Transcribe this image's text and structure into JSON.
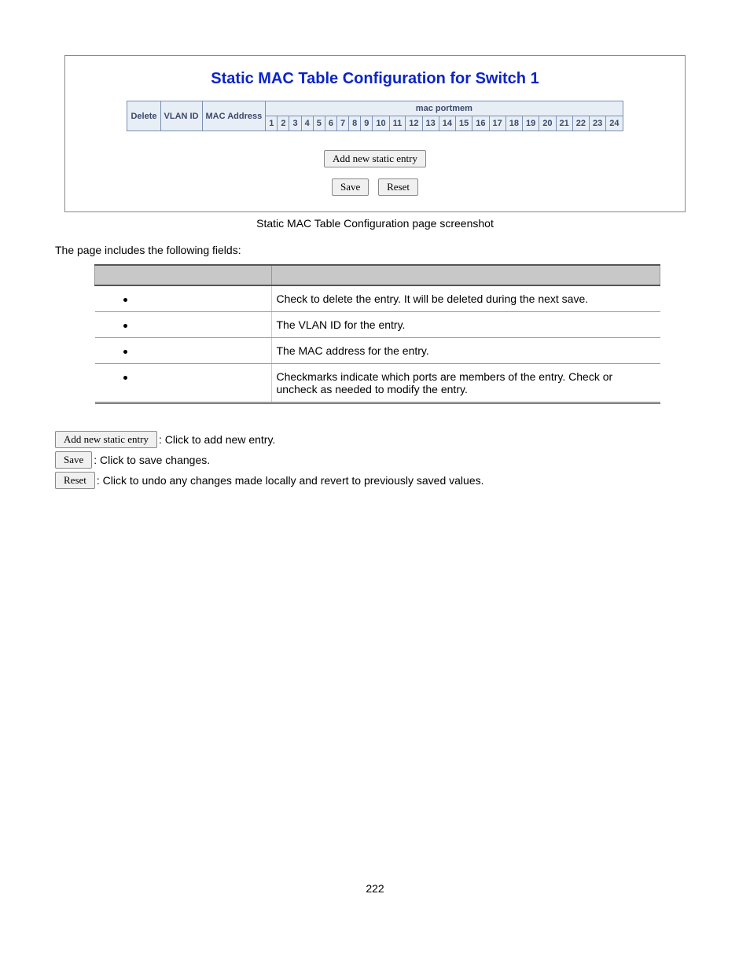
{
  "screenshot": {
    "title": "Static MAC Table Configuration for Switch 1",
    "portmem_label": "mac portmem",
    "cols": [
      "Delete",
      "VLAN ID",
      "MAC Address",
      "1",
      "2",
      "3",
      "4",
      "5",
      "6",
      "7",
      "8",
      "9",
      "10",
      "11",
      "12",
      "13",
      "14",
      "15",
      "16",
      "17",
      "18",
      "19",
      "20",
      "21",
      "22",
      "23",
      "24"
    ],
    "add_btn": "Add new static entry",
    "save_btn": "Save",
    "reset_btn": "Reset"
  },
  "caption": "Static MAC Table Configuration page screenshot",
  "intro": "The page includes the following fields:",
  "fields": [
    {
      "desc": "Check to delete the entry. It will be deleted during the next save."
    },
    {
      "desc": "The VLAN ID for the entry."
    },
    {
      "desc": "The MAC address for the entry."
    },
    {
      "desc": "Checkmarks indicate which ports are members of the entry. Check or uncheck as needed to modify the entry."
    }
  ],
  "legend": {
    "add": {
      "btn": "Add new static entry",
      "text": ": Click to add new entry."
    },
    "save": {
      "btn": "Save",
      "text": ": Click to save changes."
    },
    "reset": {
      "btn": "Reset",
      "text": ": Click to undo any changes made locally and revert to previously saved values."
    }
  },
  "page_number": "222"
}
